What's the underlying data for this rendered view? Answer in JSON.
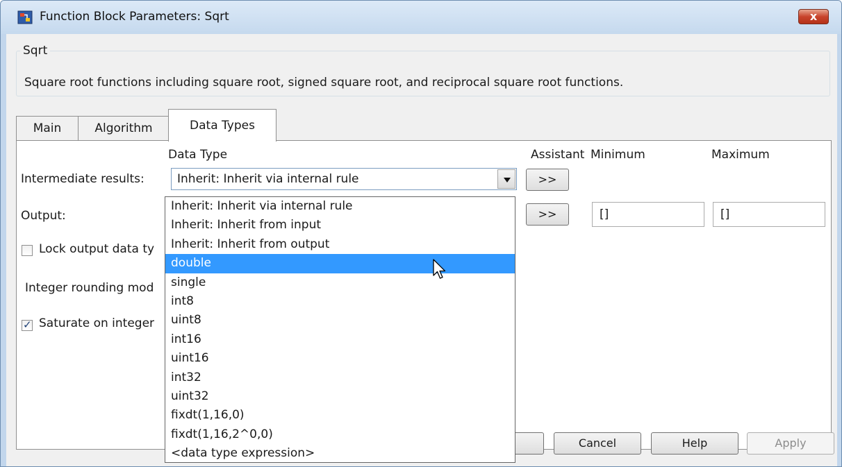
{
  "window": {
    "title": "Function Block Parameters: Sqrt",
    "close_label": "x"
  },
  "group": {
    "title": "Sqrt",
    "description": "Square root functions including square root, signed square root, and reciprocal square root functions."
  },
  "tabs": [
    {
      "label": "Main"
    },
    {
      "label": "Algorithm"
    },
    {
      "label": "Data Types"
    }
  ],
  "columns": {
    "data_type": "Data Type",
    "assistant": "Assistant",
    "minimum": "Minimum",
    "maximum": "Maximum"
  },
  "intermediate": {
    "label": "Intermediate results:",
    "value": "Inherit: Inherit via internal rule",
    "assistant_label": ">>"
  },
  "output": {
    "label": "Output:",
    "assistant_label": ">>",
    "minimum": "[]",
    "maximum": "[]"
  },
  "lock_output": {
    "label": "Lock output data ty",
    "checked": false
  },
  "rounding": {
    "label": "Integer rounding mod"
  },
  "saturate": {
    "label": "Saturate on integer",
    "checked": true
  },
  "dropdown_options": [
    "Inherit: Inherit via internal rule",
    "Inherit: Inherit from input",
    "Inherit: Inherit from output",
    "double",
    "single",
    "int8",
    "uint8",
    "int16",
    "uint16",
    "int32",
    "uint32",
    "fixdt(1,16,0)",
    "fixdt(1,16,2^0,0)",
    "<data type expression>"
  ],
  "dropdown_selected": "double",
  "buttons": {
    "cancel": "Cancel",
    "help": "Help",
    "apply": "Apply"
  }
}
